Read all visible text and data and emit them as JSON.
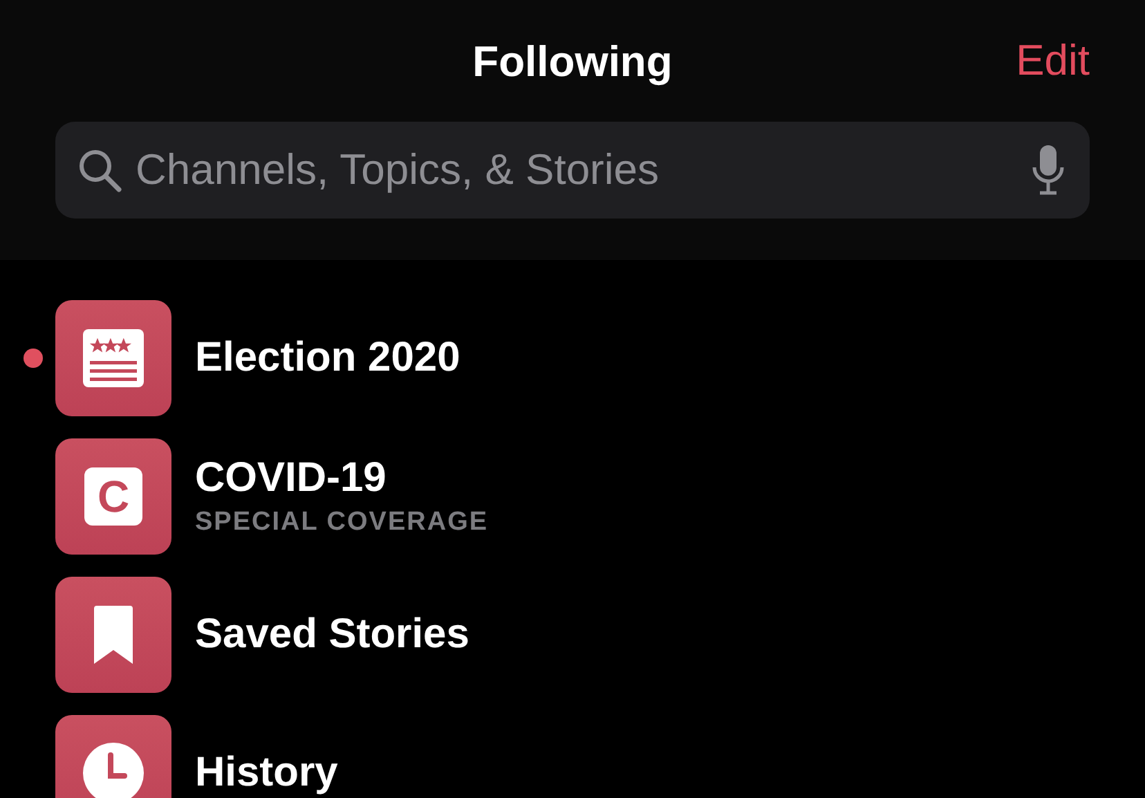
{
  "header": {
    "title": "Following",
    "edit": "Edit"
  },
  "search": {
    "placeholder": "Channels, Topics, & Stories"
  },
  "items": [
    {
      "kind": "election",
      "title": "Election 2020",
      "unread": true
    },
    {
      "kind": "letter",
      "icon_text": "C",
      "title": "COVID-19",
      "subtitle": "SPECIAL COVERAGE",
      "unread": false
    },
    {
      "kind": "bookmark",
      "title": "Saved Stories",
      "unread": false
    },
    {
      "kind": "history",
      "title": "History",
      "unread": false
    }
  ]
}
